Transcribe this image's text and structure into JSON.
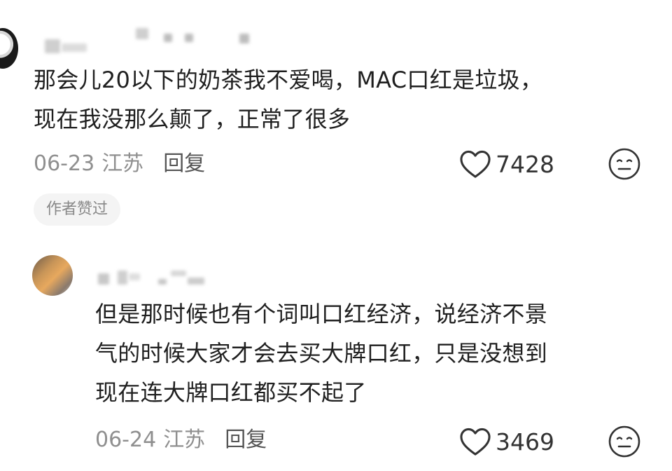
{
  "comments": [
    {
      "text_line1": "那会儿20以下的奶茶我不爱喝，MAC口红是垃圾，",
      "text_line2": "现在我没那么颠了，正常了很多",
      "date": "06-23",
      "location": "江苏",
      "reply_label": "回复",
      "likes": "7428",
      "badge": "作者赞过"
    },
    {
      "text_line1": "但是那时候也有个词叫口红经济，说经济不景",
      "text_line2": "气的时候大家才会去买大牌口红，只是没想到",
      "text_line3": "现在连大牌口红都买不起了",
      "date": "06-24",
      "location": "江苏",
      "reply_label": "回复",
      "likes": "3469"
    }
  ],
  "icons": {
    "like": "heart-outline-icon",
    "dislike": "neutral-face-icon"
  }
}
